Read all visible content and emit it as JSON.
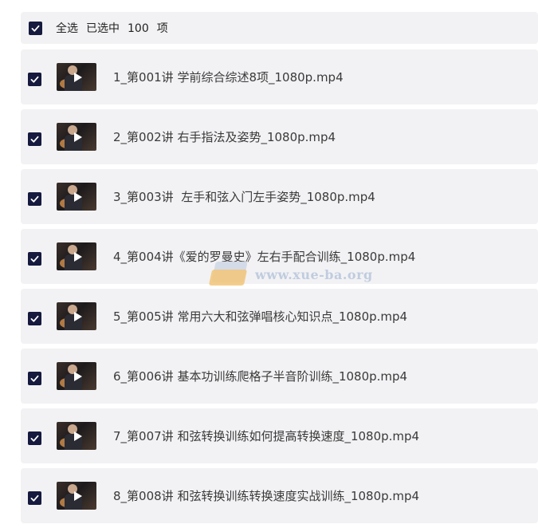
{
  "selection": {
    "select_all_label": "全选",
    "selected_prefix": "已选中",
    "selected_count": "100",
    "selected_unit": "项",
    "all_checked": true
  },
  "files": [
    {
      "name": "1_第001讲 学前综合综述8项_1080p.mp4",
      "checked": true,
      "thumbnail_icon": "video-thumbnail-icon"
    },
    {
      "name": "2_第002讲 右手指法及姿势_1080p.mp4",
      "checked": true,
      "thumbnail_icon": "video-thumbnail-icon"
    },
    {
      "name": "3_第003讲  左手和弦入门左手姿势_1080p.mp4",
      "checked": true,
      "thumbnail_icon": "video-thumbnail-icon"
    },
    {
      "name": "4_第004讲《爱的罗曼史》左右手配合训练_1080p.mp4",
      "checked": true,
      "thumbnail_icon": "video-thumbnail-icon"
    },
    {
      "name": "5_第005讲 常用六大和弦弹唱核心知识点_1080p.mp4",
      "checked": true,
      "thumbnail_icon": "video-thumbnail-icon"
    },
    {
      "name": "6_第006讲 基本功训练爬格子半音阶训练_1080p.mp4",
      "checked": true,
      "thumbnail_icon": "video-thumbnail-icon"
    },
    {
      "name": "7_第007讲 和弦转换训练如何提高转换速度_1080p.mp4",
      "checked": true,
      "thumbnail_icon": "video-thumbnail-icon"
    },
    {
      "name": "8_第008讲 和弦转换训练转换速度实战训练_1080p.mp4",
      "checked": true,
      "thumbnail_icon": "video-thumbnail-icon"
    }
  ],
  "watermark": {
    "text": "www.xue-ba.org"
  },
  "colors": {
    "checkbox": "#151a3e",
    "row_background": "#f2f2f4",
    "text": "#3a3a3a"
  }
}
